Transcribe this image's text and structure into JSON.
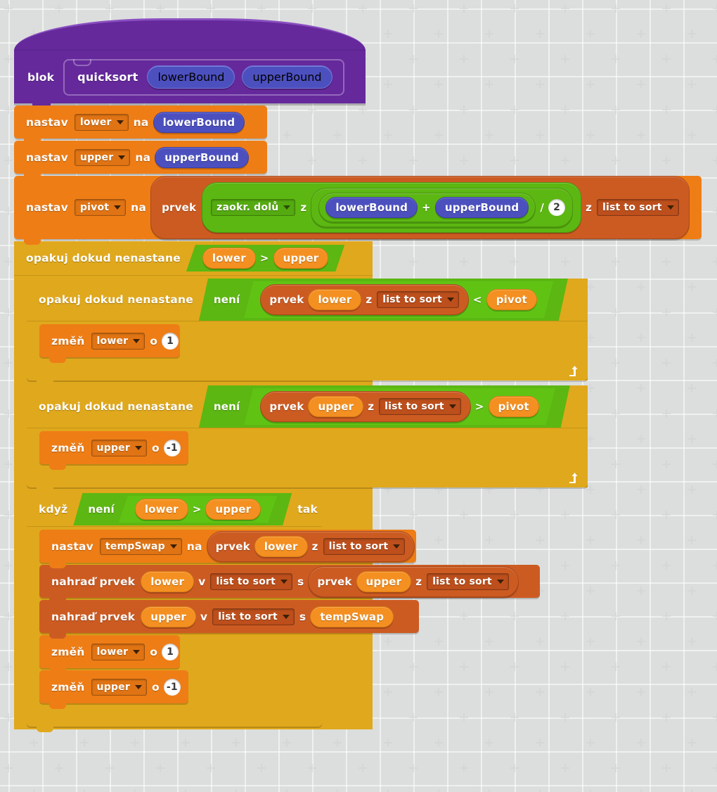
{
  "canvas": {
    "background_color": "#dcdedd",
    "grid": "plus-marks"
  },
  "palette": {
    "hat_purple": "#65299c",
    "param_blue": "#4c50bf",
    "data_orange": "#ee7d16",
    "variable_orange": "#f49021",
    "list_brown": "#cc5b22",
    "control_gold": "#e0a81c",
    "operator_green": "#5cb712"
  },
  "script": {
    "hat": {
      "label": "blok",
      "proto_name": "quicksort",
      "params": [
        "lowerBound",
        "upperBound"
      ]
    },
    "set_lower": {
      "keyword": "nastav",
      "variable": "lower",
      "to": "na",
      "value": "lowerBound"
    },
    "set_upper": {
      "keyword": "nastav",
      "variable": "upper",
      "to": "na",
      "value": "upperBound"
    },
    "set_pivot": {
      "keyword": "nastav",
      "variable": "pivot",
      "to": "na",
      "item_word": "prvek",
      "round_op": "zaokr. dolů",
      "of_word": "z",
      "operand_a": "lowerBound",
      "plus": "+",
      "operand_b": "upperBound",
      "divide": "/",
      "divisor": "2",
      "from_word": "z",
      "list": "list to sort"
    },
    "outer_loop": {
      "keyword": "opakuj dokud nenastane",
      "cond_left": "lower",
      "cond_op": ">",
      "cond_right": "upper"
    },
    "loop_lower": {
      "keyword": "opakuj dokud nenastane",
      "not_word": "není",
      "item_word": "prvek",
      "index": "lower",
      "from_word": "z",
      "list": "list to sort",
      "compare_op": "<",
      "compare_to": "pivot"
    },
    "change_lower_1": {
      "keyword": "změň",
      "variable": "lower",
      "by_word": "o",
      "amount": "1"
    },
    "loop_upper": {
      "keyword": "opakuj dokud nenastane",
      "not_word": "není",
      "item_word": "prvek",
      "index": "upper",
      "from_word": "z",
      "list": "list to sort",
      "compare_op": ">",
      "compare_to": "pivot"
    },
    "change_upper_neg1": {
      "keyword": "změň",
      "variable": "upper",
      "by_word": "o",
      "amount": "-1"
    },
    "if_block": {
      "keyword": "když",
      "not_word": "není",
      "cond_left": "lower",
      "cond_op": ">",
      "cond_right": "upper",
      "then_word": "tak"
    },
    "set_tempswap": {
      "keyword": "nastav",
      "variable": "tempSwap",
      "to": "na",
      "item_word": "prvek",
      "index": "lower",
      "from_word": "z",
      "list": "list to sort"
    },
    "replace_lower": {
      "keyword": "nahraď prvek",
      "index": "lower",
      "in_word": "v",
      "list": "list to sort",
      "with_word": "s",
      "value_item_word": "prvek",
      "value_index": "upper",
      "value_from_word": "z",
      "value_list": "list to sort"
    },
    "replace_upper": {
      "keyword": "nahraď prvek",
      "index": "upper",
      "in_word": "v",
      "list": "list to sort",
      "with_word": "s",
      "value": "tempSwap"
    },
    "change_lower_1b": {
      "keyword": "změň",
      "variable": "lower",
      "by_word": "o",
      "amount": "1"
    },
    "change_upper_neg1b": {
      "keyword": "změň",
      "variable": "upper",
      "by_word": "o",
      "amount": "-1"
    }
  }
}
